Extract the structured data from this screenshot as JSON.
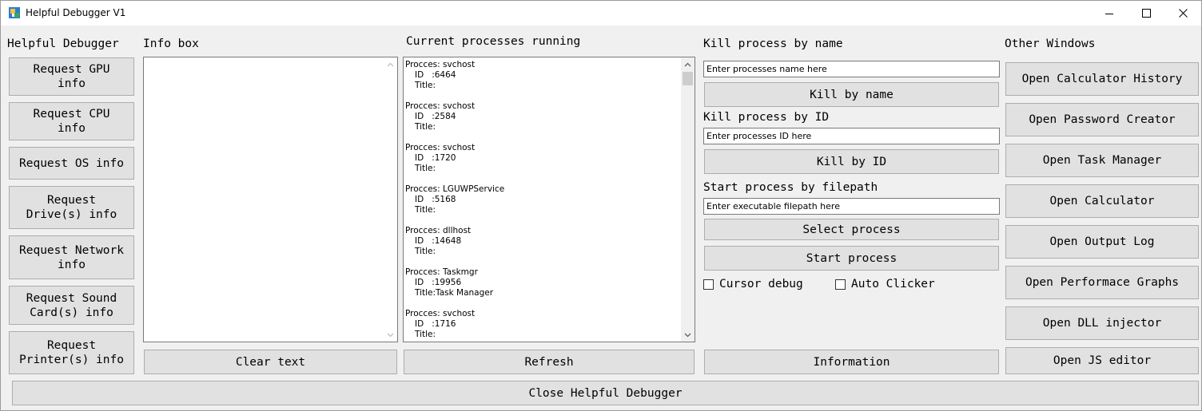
{
  "window": {
    "title": "Helpful Debugger V1",
    "icon": "debugger-app-icon",
    "controls": [
      "minimize-icon",
      "maximize-icon",
      "close-icon"
    ]
  },
  "left_panel": {
    "heading": "Helpful Debugger",
    "buttons": [
      "Request GPU\ninfo",
      "Request CPU\ninfo",
      "Request OS info",
      "Request\nDrive(s) info",
      "Request Network\ninfo",
      "Request Sound\nCard(s) info",
      "Request\nPrinter(s) info"
    ]
  },
  "info_box": {
    "heading": "Info box",
    "content": "",
    "clear_label": "Clear text"
  },
  "processes": {
    "heading": "Current processes running",
    "refresh_label": "Refresh",
    "items": [
      {
        "name": "Procces: svchost",
        "id": "ID   :6464",
        "title": "Title:"
      },
      {
        "name": "Procces: svchost",
        "id": "ID   :2584",
        "title": "Title:"
      },
      {
        "name": "Procces: svchost",
        "id": "ID   :1720",
        "title": "Title:"
      },
      {
        "name": "Procces: LGUWPService",
        "id": "ID   :5168",
        "title": "Title:"
      },
      {
        "name": "Procces: dllhost",
        "id": "ID   :14648",
        "title": "Title:"
      },
      {
        "name": "Procces: Taskmgr",
        "id": "ID   :19956",
        "title": "Title:Task Manager"
      },
      {
        "name": "Procces: svchost",
        "id": "ID   :1716",
        "title": "Title:"
      }
    ]
  },
  "kill": {
    "by_name_heading": "Kill process by name",
    "name_placeholder": "Enter processes name here",
    "by_name_button": "Kill by name",
    "by_id_heading": "Kill process by ID",
    "id_placeholder": "Enter processes ID here",
    "by_id_button": "Kill by ID"
  },
  "start": {
    "heading": "Start process by filepath",
    "path_placeholder": "Enter executable filepath here",
    "select_button": "Select process",
    "start_button": "Start process",
    "cursor_debug_label": "Cursor debug",
    "auto_clicker_label": "Auto Clicker",
    "information_button": "Information"
  },
  "other_windows": {
    "heading": "Other Windows",
    "buttons": [
      "Open Calculator History",
      "Open Password Creator",
      "Open Task Manager",
      "Open Calculator",
      "Open Output Log",
      "Open Performace Graphs",
      "Open DLL injector",
      "Open JS editor"
    ]
  },
  "footer": {
    "close_label": "Close Helpful Debugger"
  },
  "colors": {
    "window_bg": "#f0f0f0",
    "button_bg": "#e1e1e1",
    "button_border": "#adadad",
    "titlebar_bg": "#ffffff"
  }
}
